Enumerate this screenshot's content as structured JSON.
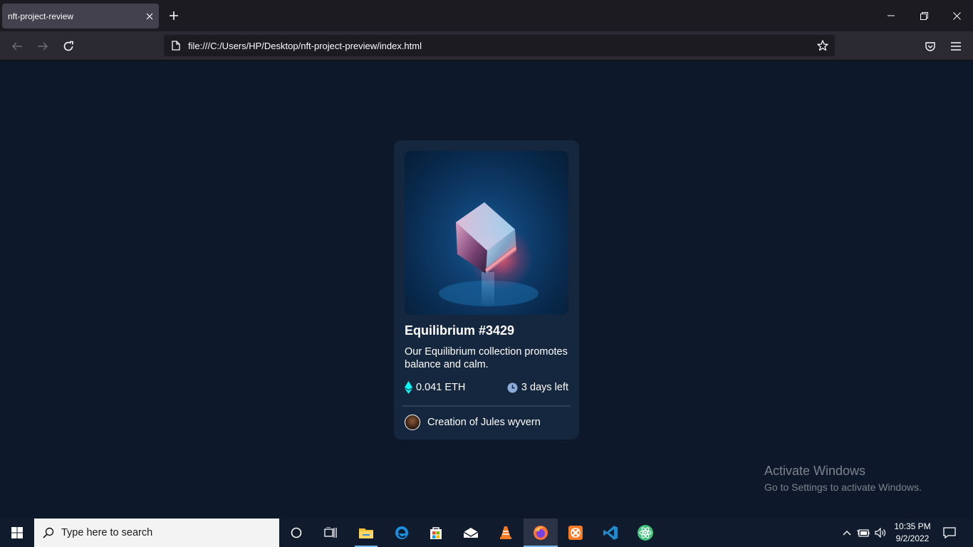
{
  "browser": {
    "tab_title": "nft-project-review",
    "url": "file:///C:/Users/HP/Desktop/nft-project-preview/index.html",
    "icons": {
      "tab_close": "close-icon",
      "new_tab": "plus-icon",
      "back": "arrow-left-icon",
      "forward": "arrow-right-icon",
      "reload": "reload-icon",
      "page": "page-icon",
      "bookmark": "star-icon",
      "pocket": "pocket-icon",
      "menu": "hamburger-menu-icon",
      "minimize": "minimize-icon",
      "restore": "restore-icon",
      "close_window": "close-icon"
    }
  },
  "card": {
    "title": "Equilibrium #3429",
    "description": "Our Equilibrium collection promotes balance and calm.",
    "price": "0.041 ETH",
    "time_left": "3 days left",
    "creator_prefix": "Creation of",
    "creator_name": "Jules wyvern",
    "colors": {
      "background": "#0d192b",
      "card": "#15263f",
      "accent_cyan": "#00fff8",
      "soft_blue": "#8bacd9"
    }
  },
  "watermark": {
    "title": "Activate Windows",
    "subtitle": "Go to Settings to activate Windows."
  },
  "taskbar": {
    "search_placeholder": "Type here to search",
    "time": "10:35 PM",
    "date": "9/2/2022",
    "apps": [
      "cortana-icon",
      "task-view-icon",
      "file-explorer-icon",
      "edge-icon",
      "store-icon",
      "mail-icon",
      "vlc-icon",
      "firefox-icon",
      "xampp-icon",
      "vscode-icon",
      "atom-icon"
    ]
  }
}
